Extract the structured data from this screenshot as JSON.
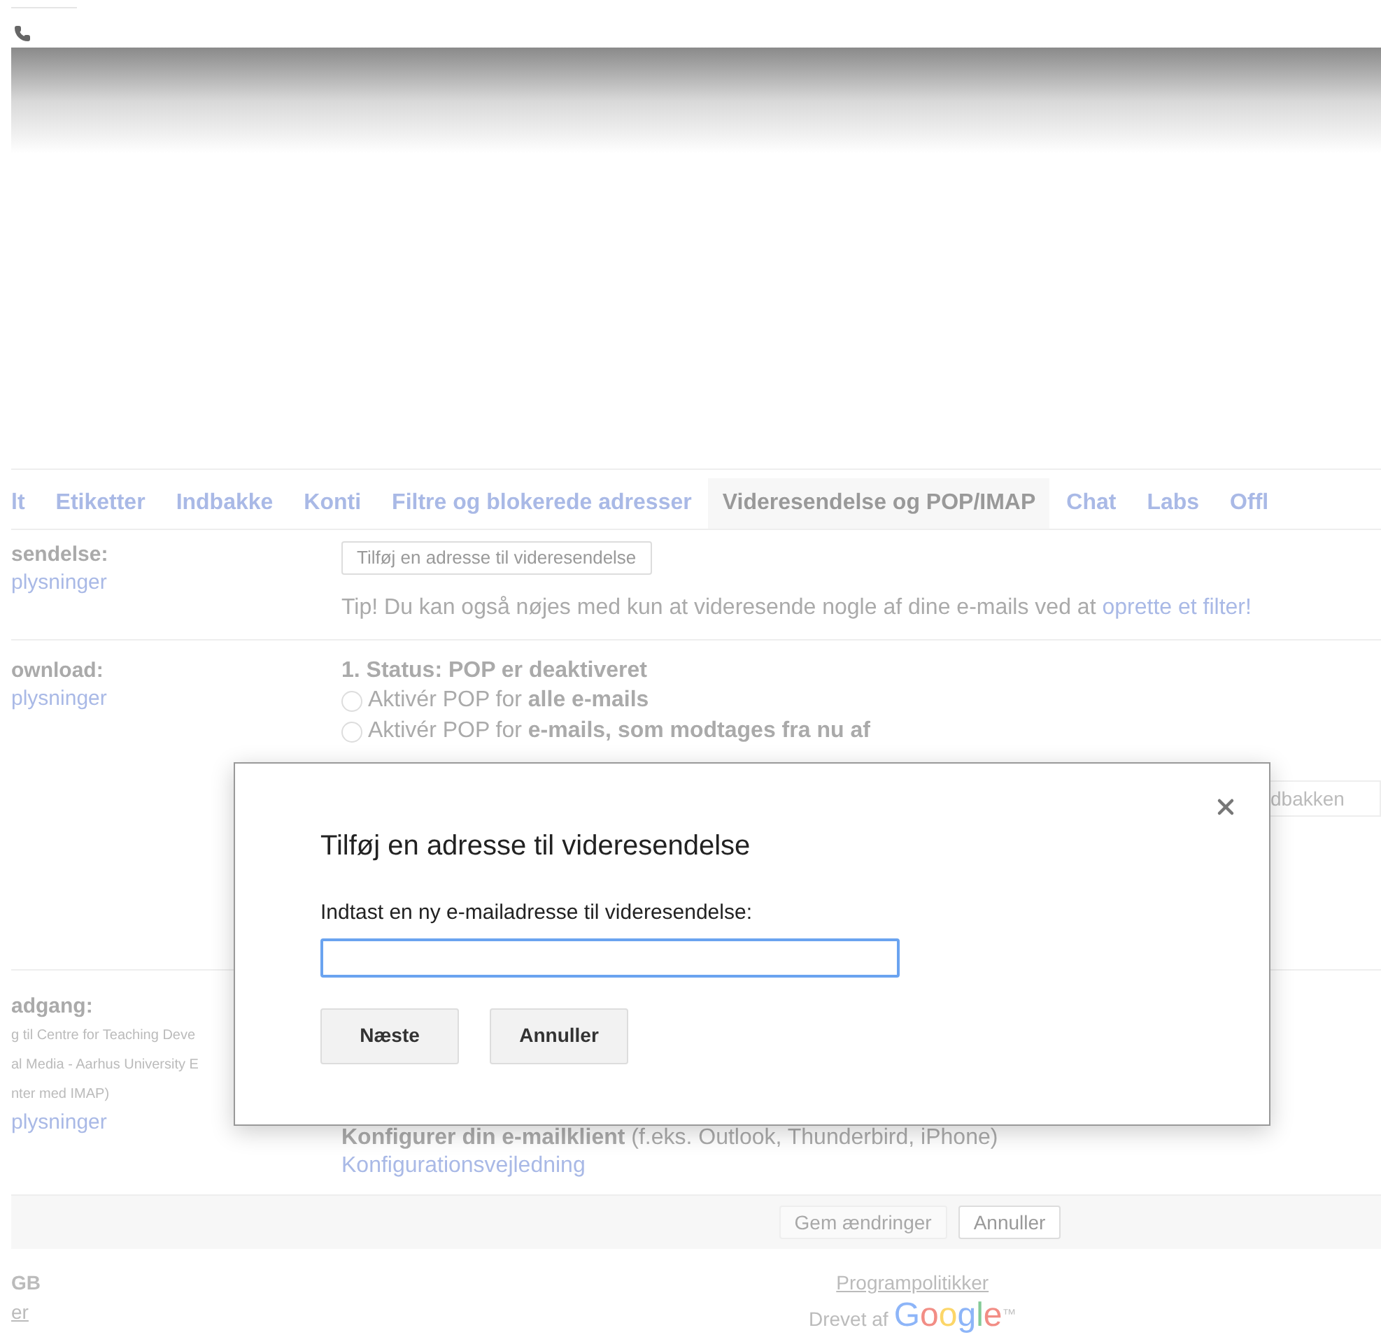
{
  "tabs": [
    {
      "label": "lt",
      "selected": false
    },
    {
      "label": "Etiketter",
      "selected": false
    },
    {
      "label": "Indbakke",
      "selected": false
    },
    {
      "label": "Konti",
      "selected": false
    },
    {
      "label": "Filtre og blokerede adresser",
      "selected": false
    },
    {
      "label": "Videresendelse og POP/IMAP",
      "selected": true
    },
    {
      "label": "Chat",
      "selected": false
    },
    {
      "label": "Labs",
      "selected": false
    },
    {
      "label": "Offl",
      "selected": false
    }
  ],
  "forwarding": {
    "title": "sendelse:",
    "link": "plysninger",
    "button": "Tilføj en adresse til videresendelse",
    "tip": "Tip! Du kan også nøjes med kun at videresende nogle af dine e-mails ved at",
    "tip_link": "oprette et filter!"
  },
  "pop": {
    "title": "ownload:",
    "link": "plysninger",
    "status": "1. Status: POP er deaktiveret",
    "options": [
      {
        "label": "Aktivér POP for **alle e-mails**",
        "selected": false
      },
      {
        "label": "Aktivér POP for **e-mails, som modtages fra nu af**",
        "selected": false
      }
    ],
    "dropdown": "dbakken"
  },
  "imap": {
    "title": "adgang:",
    "notes": [
      "g til Centre for Teaching Deve",
      "al Media - Aarhus University E",
      "nter med IMAP)"
    ],
    "link": "plysninger",
    "configure": "**Konfigurer din e-mailklient** (f.eks. Outlook, Thunderbird, iPhone)",
    "guide_link": "Konfigurationsvejledning"
  },
  "actions": [
    {
      "label": "Gem ændringer",
      "disabled": true
    },
    {
      "label": "Annuller",
      "disabled": false
    }
  ],
  "footer": {
    "storage": "GB",
    "storage_link": "er",
    "policy_link": "Programpolitikker",
    "powered_by": "Drevet af",
    "logo": "Google",
    "tm": "™"
  },
  "dialog": {
    "title": "Tilføj en adresse til videresendelse",
    "label": "Indtast en ny e-mailadresse til videresendelse:",
    "buttons": [
      "Næste",
      "Annuller"
    ]
  }
}
